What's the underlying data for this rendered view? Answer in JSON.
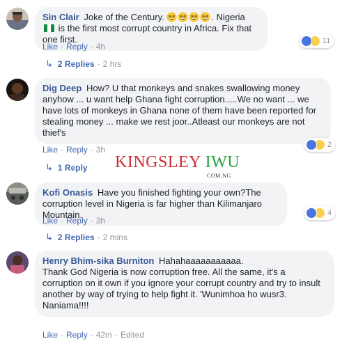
{
  "colors": {
    "link": "#4267b2",
    "name": "#385898",
    "bubble": "#f2f3f5",
    "watermark_red": "#d12a33",
    "watermark_green": "#24a338"
  },
  "action_labels": {
    "like": "Like",
    "reply": "Reply",
    "separator": "·"
  },
  "watermark": {
    "part1": "KINGSLEY ",
    "part2": "IWU",
    "sub": "COM.NG"
  },
  "comments": [
    {
      "author": "Sin Clair",
      "text_before_emoji": "Joke of the Century. ",
      "emoji": [
        "grinning-squint-face",
        "grinning-squint-face",
        "grinning-squint-face",
        "grinning-squint-face"
      ],
      "text_mid": ". Nigeria ",
      "flag": "nigeria-flag",
      "text_after": " is the first most corrupt country in Africa. Fix that one first.",
      "time": "4h",
      "edited": "",
      "reactions": [
        "like",
        "haha"
      ],
      "reaction_count": "11",
      "replies_label": "2 Replies",
      "replies_time": "2 hrs"
    },
    {
      "author": "Dig Deep",
      "text": "How? U that monkeys and snakes swallowing money anyhow ... u want help Ghana fight corruption.....We no want ... we have lots of monkeys in Ghana none of them have been reported for stealing money ... make we rest joor..Atleast our monkeys are not thief's",
      "time": "3h",
      "reactions": [
        "like",
        "haha"
      ],
      "reaction_count": "2",
      "replies_label": "1 Reply",
      "replies_time": ""
    },
    {
      "author": "Kofi Onasis",
      "text": "Have you finished fighting your own?The corruption level in Nigeria is far higher than Kilimanjaro Mountain.",
      "time": "3h",
      "reactions": [
        "like",
        "haha"
      ],
      "reaction_count": "4",
      "replies_label": "2 Replies",
      "replies_time": "2 mins"
    },
    {
      "author": "Henry Bhim-sika Burniton",
      "text_line1": "Hahahaaaaaaaaaaa.",
      "text_body": "Thank God Nigeria is now corruption free. All the same, it's a corruption on it own if you ignore your corrupt country and try to insult another by way of trying to help fight it. 'Wunimhoa ho wusr3.",
      "text_last": "Naniama!!!!",
      "time": "42m",
      "edited": "Edited"
    }
  ]
}
